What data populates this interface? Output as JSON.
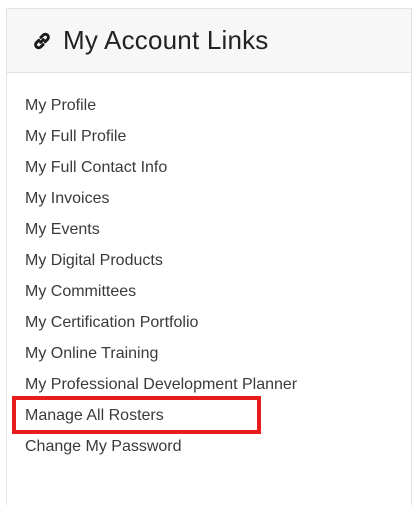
{
  "panel": {
    "title": "My Account Links",
    "icon": "link-icon"
  },
  "links": [
    "My Profile",
    "My Full Profile",
    "My Full Contact Info",
    "My Invoices",
    "My Events",
    "My Digital Products",
    "My Committees",
    "My Certification Portfolio",
    "My Online Training",
    "My Professional Development Planner",
    "Manage All Rosters",
    "Change My Password"
  ],
  "colors": {
    "highlight": "#e81c1c",
    "header_bg": "#f7f7f7",
    "link_text": "#3a3a3a"
  }
}
